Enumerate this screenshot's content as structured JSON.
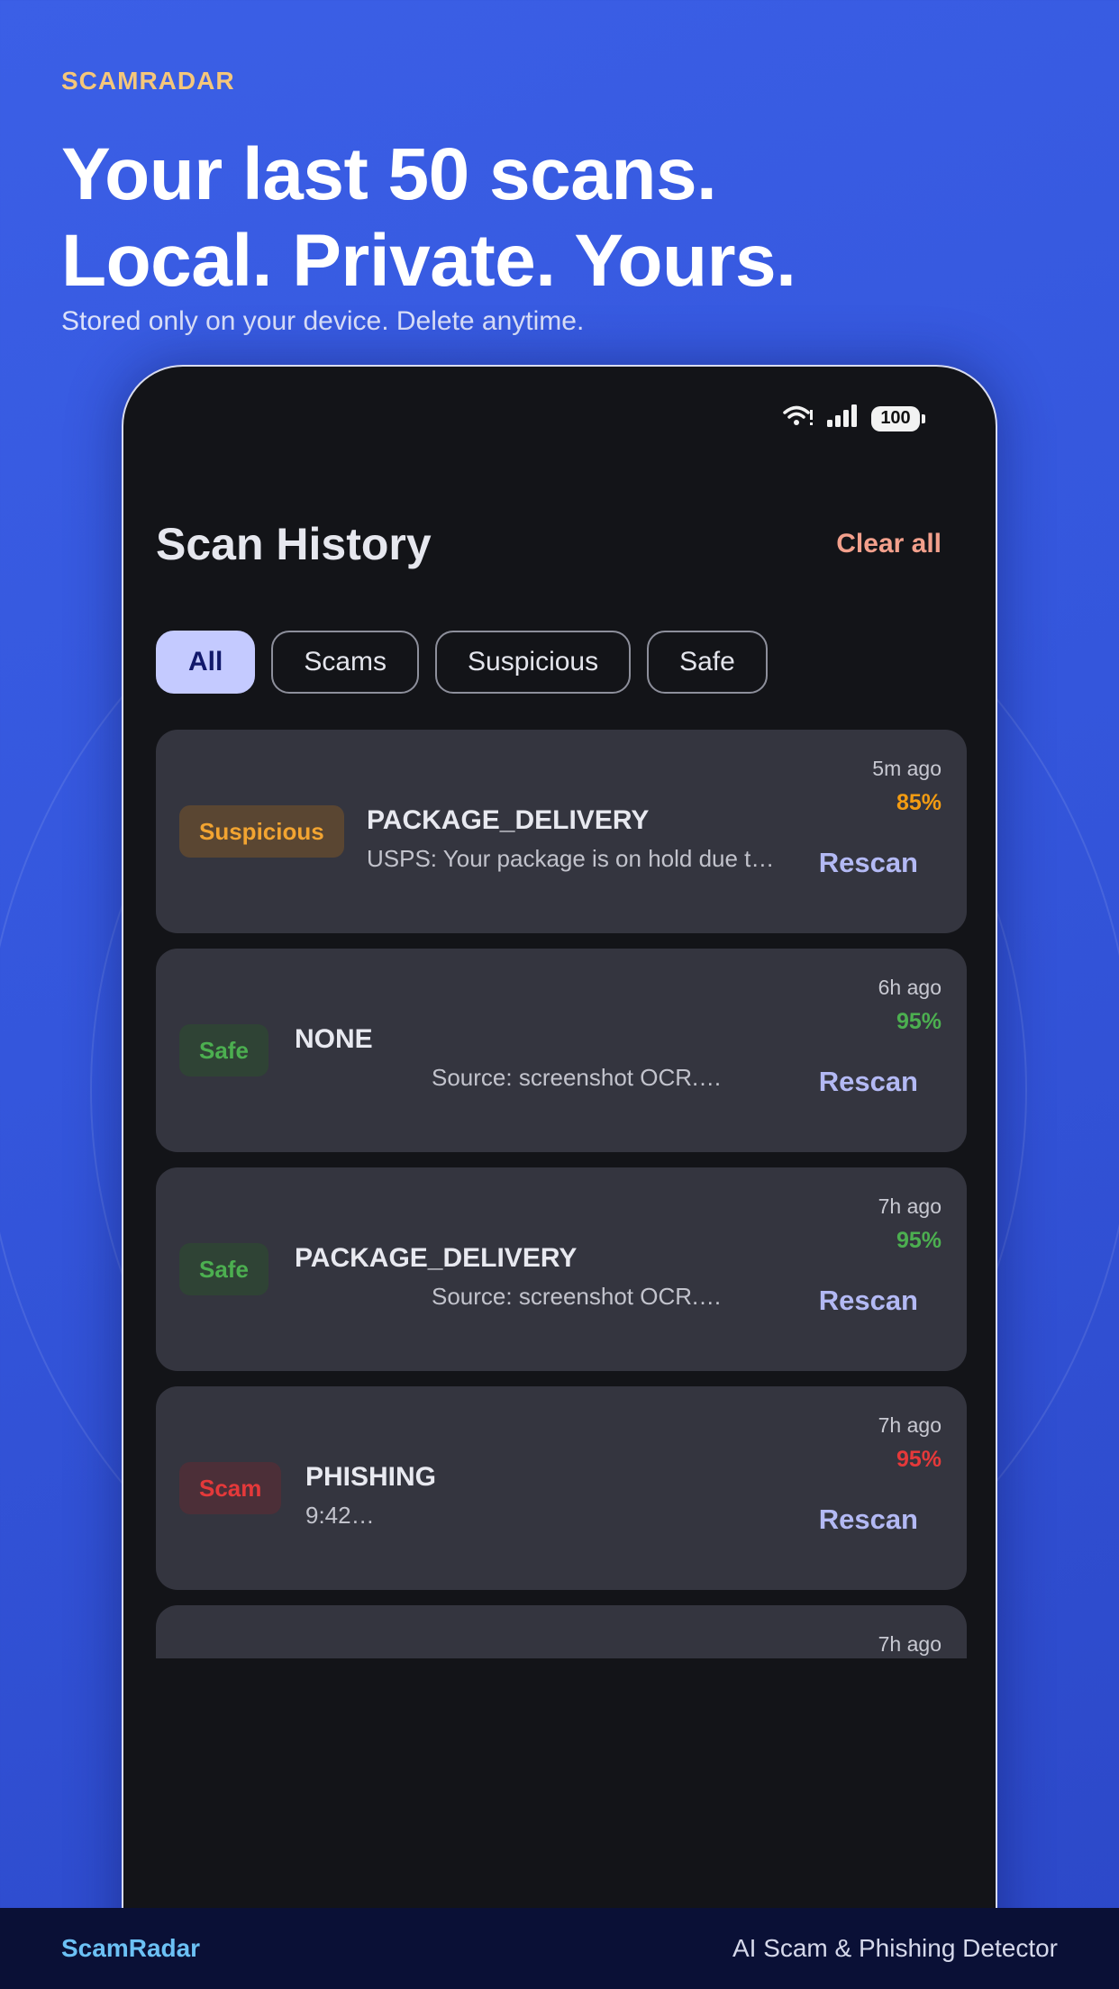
{
  "promo": {
    "brand": "SCAMRADAR",
    "headline_line1": "Your last 50 scans.",
    "headline_line2": "Local. Private. Yours.",
    "subline": "Stored only on your device. Delete anytime."
  },
  "status_bar": {
    "battery": "100",
    "icons": [
      "wifi-icon",
      "signal-icon",
      "battery-icon"
    ]
  },
  "screen": {
    "title": "Scan History",
    "clear_all": "Clear all"
  },
  "filters": [
    {
      "label": "All",
      "active": true
    },
    {
      "label": "Scams",
      "active": false
    },
    {
      "label": "Suspicious",
      "active": false
    },
    {
      "label": "Safe",
      "active": false
    }
  ],
  "scans": [
    {
      "badge": "Suspicious",
      "category": "PACKAGE_DELIVERY",
      "preview": "USPS: Your package is on hold due t…",
      "time": "5m ago",
      "confidence": "85%",
      "action": "Rescan"
    },
    {
      "badge": "Safe",
      "category": "NONE",
      "preview": "Source: screenshot OCR.…",
      "time": "6h ago",
      "confidence": "95%",
      "action": "Rescan"
    },
    {
      "badge": "Safe",
      "category": "PACKAGE_DELIVERY",
      "preview": "Source: screenshot OCR.…",
      "time": "7h ago",
      "confidence": "95%",
      "action": "Rescan"
    },
    {
      "badge": "Scam",
      "category": "PHISHING",
      "preview": "9:42…",
      "time": "7h ago",
      "confidence": "95%",
      "action": "Rescan"
    },
    {
      "time": "7h ago"
    }
  ],
  "footer": {
    "brand": "ScamRadar",
    "tagline": "AI Scam & Phishing Detector"
  },
  "colors": {
    "background": "#3456dc",
    "accent": "#c4caff",
    "suspicious": "#f39c12",
    "safe": "#4caf50",
    "scam": "#e5393a"
  }
}
